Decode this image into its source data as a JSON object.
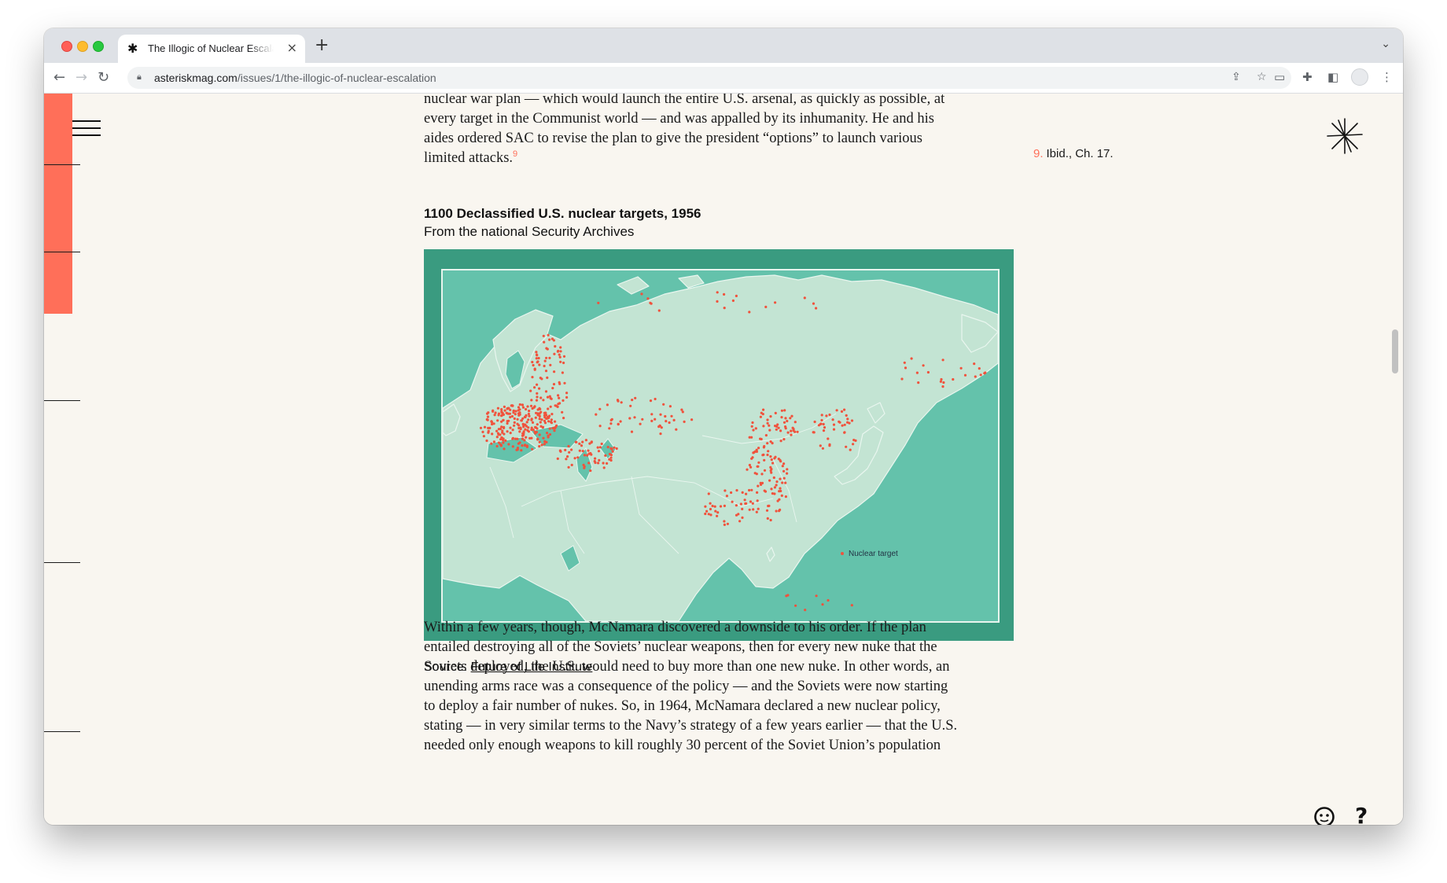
{
  "browser": {
    "tab_favicon": "✱",
    "tab_title": "The Illogic of Nuclear Escalation",
    "tab_close": "×",
    "new_tab": "+",
    "tab_menu": "⌄",
    "url_host": "asteriskmag.com",
    "url_path": "/issues/1/the-illogic-of-nuclear-escalation",
    "icons": [
      "back-arrow-icon",
      "forward-arrow-icon",
      "reload-icon",
      "lock-icon",
      "share-icon",
      "bookmark-star-icon",
      "cast-icon",
      "extensions-icon",
      "side-panel-icon",
      "profile-avatar",
      "kebab-menu-icon"
    ]
  },
  "article": {
    "para_top_lines": [
      "nuclear war plan — which would launch the entire U.S. arsenal, as quickly as possible, at",
      "every target in the Communist world — and was appalled by its inhumanity. He and his",
      "aides ordered SAC to revise the plan to give the president “options” to launch various",
      "limited attacks."
    ],
    "para_top_fn": "9",
    "footnote_num": "9.",
    "footnote_text": "Ibid., Ch. 17.",
    "figure_title": "1100 Declassified U.S. nuclear targets, 1956",
    "figure_subtitle": "From the national Security Archives",
    "legend_label": "Nuclear target",
    "source_prefix": "Source:",
    "source_link": "Future of Life Institute",
    "para_bottom_lines": [
      "Within a few years, though, McNamara discovered a downside to his order. If the plan",
      "entailed destroying all of the Soviets’ nuclear weapons, then for every new nuke that the",
      "Soviets deployed, the U.S. would need to buy more than one new nuke. In other words, an",
      "unending arms race was a consequence of the policy — and the Soviets were now starting",
      "to deploy a fair number of nukes. So, in 1964, McNamara declared a new nuclear policy,",
      "stating — in very similar terms to the Navy’s strategy of a few years earlier — that the U.S.",
      "needed only enough weapons to kill roughly 30 percent of the Soviet Union’s population"
    ]
  },
  "colors": {
    "accent": "#ff6f59",
    "page_bg": "#f9f6f0",
    "map_frame": "#3a9b80",
    "map_sea": "#64c2ab",
    "map_land": "#c3e4d3",
    "target_dot": "#f0523c"
  }
}
